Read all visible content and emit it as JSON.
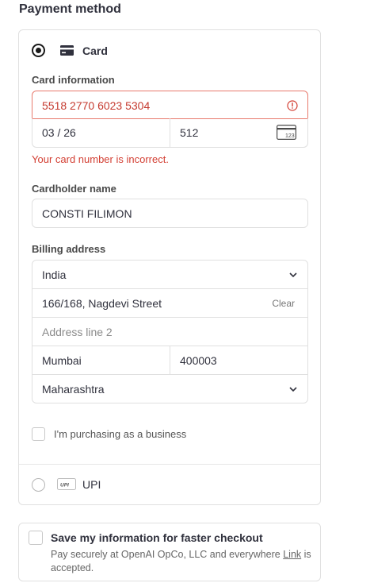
{
  "title": "Payment method",
  "card_option": {
    "label": "Card",
    "selected": true
  },
  "card_info": {
    "label": "Card information",
    "number": "5518 2770 6023 5304",
    "expiry": "03 / 26",
    "cvc": "512",
    "error": "Your card number is incorrect."
  },
  "cardholder": {
    "label": "Cardholder name",
    "value": "CONSTI FILIMON"
  },
  "billing": {
    "label": "Billing address",
    "country": "India",
    "line1": "166/168, Nagdevi Street",
    "clear_label": "Clear",
    "line2_placeholder": "Address line 2",
    "city": "Mumbai",
    "postal": "400003",
    "state": "Maharashtra"
  },
  "business": {
    "label": "I'm purchasing as a business"
  },
  "upi_option": {
    "label": "UPI",
    "logo_text": "UPI"
  },
  "save_info": {
    "title": "Save my information for faster checkout",
    "desc_before": "Pay securely at OpenAI OpCo, LLC and everywhere ",
    "desc_link": "Link",
    "desc_after": " is accepted."
  },
  "colors": {
    "error": "#d33f33",
    "border": "#e0e0e0"
  },
  "icons": {
    "card": "card-icon",
    "error": "error-icon",
    "cvc": "cvc-card-icon",
    "chevron": "chevron-down-icon"
  }
}
